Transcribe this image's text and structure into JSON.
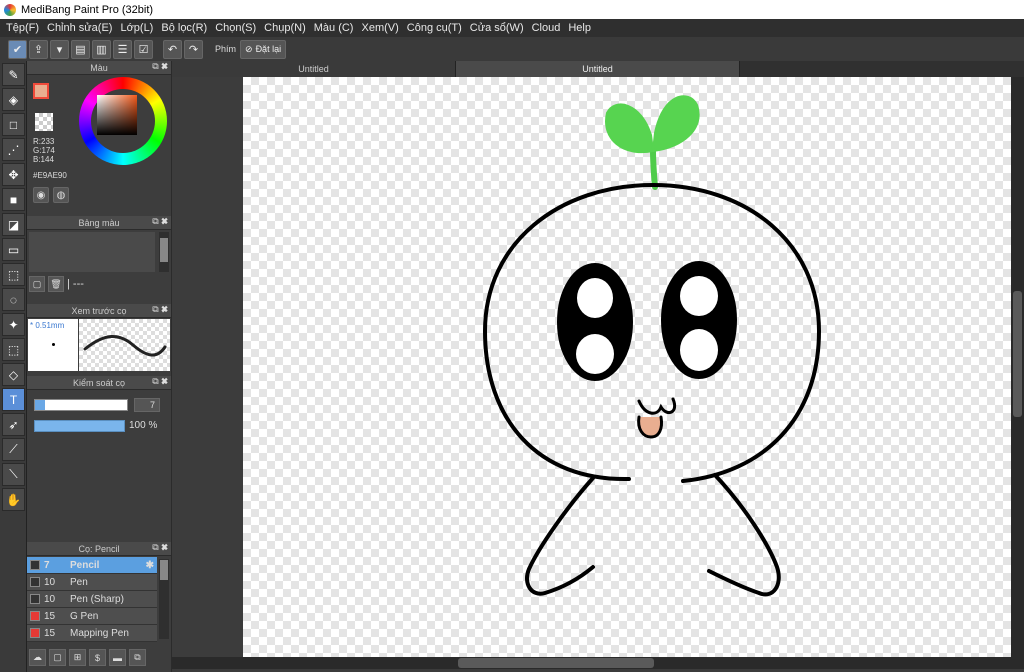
{
  "window": {
    "title": "MediBang Paint Pro (32bit)"
  },
  "menu": [
    "Tệp(F)",
    "Chỉnh sửa(E)",
    "Lớp(L)",
    "Bộ lọc(R)",
    "Chọn(S)",
    "Chụp(N)",
    "Màu (C)",
    "Xem(V)",
    "Công cụ(T)",
    "Cửa sổ(W)",
    "Cloud",
    "Help"
  ],
  "toolbar": {
    "key_label": "Phím",
    "reset_label": "Đặt lại"
  },
  "color_panel": {
    "title": "Màu",
    "r": "R:233",
    "g": "G:174",
    "b": "B:144",
    "hex": "#E9AE90",
    "current_color": "#E9AE90"
  },
  "swatch_panel": {
    "title": "Bảng màu",
    "footer_text": "| ---"
  },
  "brush_preview": {
    "title": "Xem trước cọ",
    "size": "* 0.51mm"
  },
  "brush_control": {
    "title": "Kiểm soát cọ",
    "size_value": "7",
    "opacity_value": "100 %"
  },
  "brush_panel": {
    "title": "Cọ: Pencil",
    "brushes": [
      {
        "size": "7",
        "name": "Pencil",
        "color": "#333333"
      },
      {
        "size": "10",
        "name": "Pen",
        "color": "#333333"
      },
      {
        "size": "10",
        "name": "Pen (Sharp)",
        "color": "#333333"
      },
      {
        "size": "15",
        "name": "G Pen",
        "color": "#e53935"
      },
      {
        "size": "15",
        "name": "Mapping Pen",
        "color": "#e53935"
      }
    ]
  },
  "tabs": [
    "Untitled",
    "Untitled"
  ]
}
